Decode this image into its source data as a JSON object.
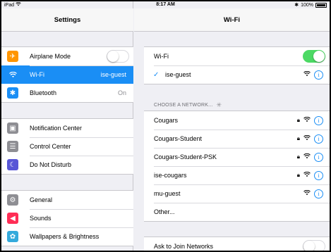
{
  "status_bar": {
    "device": "iPad",
    "wifi_icon": "wifi-icon",
    "time": "8:17 AM",
    "bluetooth_icon": "bluetooth-icon",
    "battery": "100%"
  },
  "master": {
    "title": "Settings",
    "group1": [
      {
        "label": "Airplane Mode",
        "icon": "airplane-icon",
        "color": "#ff9500",
        "toggle": false
      },
      {
        "label": "Wi-Fi",
        "icon": "wifi-icon",
        "color": "#1a8ef5",
        "value": "ise-guest",
        "selected": true
      },
      {
        "label": "Bluetooth",
        "icon": "bluetooth-icon",
        "color": "#1a8ef5",
        "value": "On"
      }
    ],
    "group2": [
      {
        "label": "Notification Center",
        "icon": "notification-center-icon",
        "color": "#8e8e93"
      },
      {
        "label": "Control Center",
        "icon": "control-center-icon",
        "color": "#8e8e93"
      },
      {
        "label": "Do Not Disturb",
        "icon": "moon-icon",
        "color": "#5856d6"
      }
    ],
    "group3": [
      {
        "label": "General",
        "icon": "gear-icon",
        "color": "#8e8e93"
      },
      {
        "label": "Sounds",
        "icon": "speaker-icon",
        "color": "#ff2d55"
      },
      {
        "label": "Wallpapers & Brightness",
        "icon": "flower-icon",
        "color": "#34aadc"
      }
    ]
  },
  "detail": {
    "title": "Wi-Fi",
    "wifi_label": "Wi-Fi",
    "wifi_on": true,
    "connected_network": "ise-guest",
    "section_label": "CHOOSE A NETWORK...",
    "networks": [
      {
        "name": "Cougars",
        "locked": true
      },
      {
        "name": "Cougars-Student",
        "locked": true
      },
      {
        "name": "Cougars-Student-PSK",
        "locked": true
      },
      {
        "name": "ise-cougars",
        "locked": true
      },
      {
        "name": "mu-guest",
        "locked": false
      }
    ],
    "other_label": "Other...",
    "ask_to_join_label": "Ask to Join Networks",
    "ask_to_join_on": false
  }
}
